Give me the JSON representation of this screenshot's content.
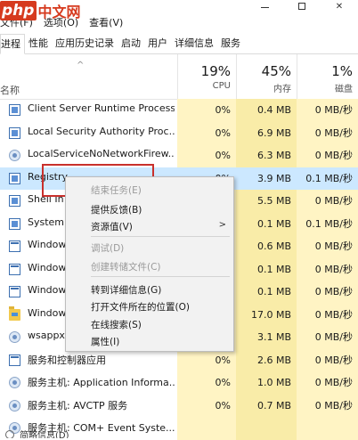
{
  "logo": {
    "mark": "php",
    "suffix": "中文网"
  },
  "window": {
    "close_glyph": "✕"
  },
  "menubar": [
    "文件(F)",
    "选项(O)",
    "查看(V)"
  ],
  "tabs": [
    "进程",
    "性能",
    "应用历史记录",
    "启动",
    "用户",
    "详细信息",
    "服务"
  ],
  "active_tab": "进程",
  "header": {
    "name": "名称",
    "sort_arrow": "^",
    "cpu": {
      "pct": "19%",
      "label": "CPU"
    },
    "mem": {
      "pct": "45%",
      "label": "内存"
    },
    "disk": {
      "pct": "1%",
      "label": "磁盘"
    }
  },
  "rows": [
    {
      "name": "Client Server Runtime Process",
      "cpu": "0%",
      "mem": "0.4 MB",
      "disk": "0 MB/秒",
      "icon": "process-icon"
    },
    {
      "name": "Local Security Authority Proc...",
      "cpu": "0%",
      "mem": "6.9 MB",
      "disk": "0 MB/秒",
      "icon": "process-icon"
    },
    {
      "name": "LocalServiceNoNetworkFirew...",
      "cpu": "0%",
      "mem": "6.3 MB",
      "disk": "0 MB/秒",
      "icon": "gear-icon"
    },
    {
      "name": "Registry",
      "cpu": "0%",
      "mem": "3.9 MB",
      "disk": "0.1 MB/秒",
      "icon": "process-icon"
    },
    {
      "name": "Shell In",
      "cpu": "",
      "mem": "5.5 MB",
      "disk": "0 MB/秒",
      "icon": "process-icon"
    },
    {
      "name": "System",
      "cpu": "",
      "mem": "0.1 MB",
      "disk": "0.1 MB/秒",
      "icon": "process-icon"
    },
    {
      "name": "Window",
      "cpu": "",
      "mem": "0.6 MB",
      "disk": "0 MB/秒",
      "icon": "window-icon"
    },
    {
      "name": "Window",
      "cpu": "",
      "mem": "0.1 MB",
      "disk": "0 MB/秒",
      "icon": "window-icon"
    },
    {
      "name": "Window",
      "cpu": "",
      "mem": "0.1 MB",
      "disk": "0 MB/秒",
      "icon": "window-icon"
    },
    {
      "name": "Window",
      "cpu": "",
      "mem": "17.0 MB",
      "disk": "0 MB/秒",
      "icon": "folder-icon"
    },
    {
      "name": "wsappx",
      "cpu": "",
      "mem": "3.1 MB",
      "disk": "0 MB/秒",
      "icon": "gear-icon"
    },
    {
      "name": "服务和控制器应用",
      "cpu": "0%",
      "mem": "2.6 MB",
      "disk": "0 MB/秒",
      "icon": "window-icon"
    },
    {
      "name": "服务主机: Application Informa...",
      "cpu": "0%",
      "mem": "1.0 MB",
      "disk": "0 MB/秒",
      "icon": "gear-icon"
    },
    {
      "name": "服务主机: AVCTP 服务",
      "cpu": "0%",
      "mem": "0.7 MB",
      "disk": "0 MB/秒",
      "icon": "gear-icon"
    },
    {
      "name": "服务主机: COM+ Event Syste...",
      "cpu": "",
      "mem": "",
      "disk": "",
      "icon": "gear-icon"
    }
  ],
  "context_menu": {
    "items": [
      {
        "label": "结束任务(E)",
        "disabled": true
      },
      {
        "label": "提供反馈(B)",
        "disabled": false
      },
      {
        "label": "资源值(V)",
        "disabled": false,
        "submenu_arrow": ">"
      },
      {
        "label": "调试(D)",
        "disabled": true
      },
      {
        "label": "创建转储文件(C)",
        "disabled": true
      },
      {
        "label": "转到详细信息(G)",
        "disabled": false
      },
      {
        "label": "打开文件所在的位置(O)",
        "disabled": false
      },
      {
        "label": "在线搜索(S)",
        "disabled": false
      },
      {
        "label": "属性(I)",
        "disabled": false
      }
    ]
  },
  "footer": {
    "text": "简略信息(D)"
  },
  "colors": {
    "highlight_box": "#c9302c",
    "usage_fill": "#fff4c4",
    "selected_row": "#cce8ff"
  }
}
